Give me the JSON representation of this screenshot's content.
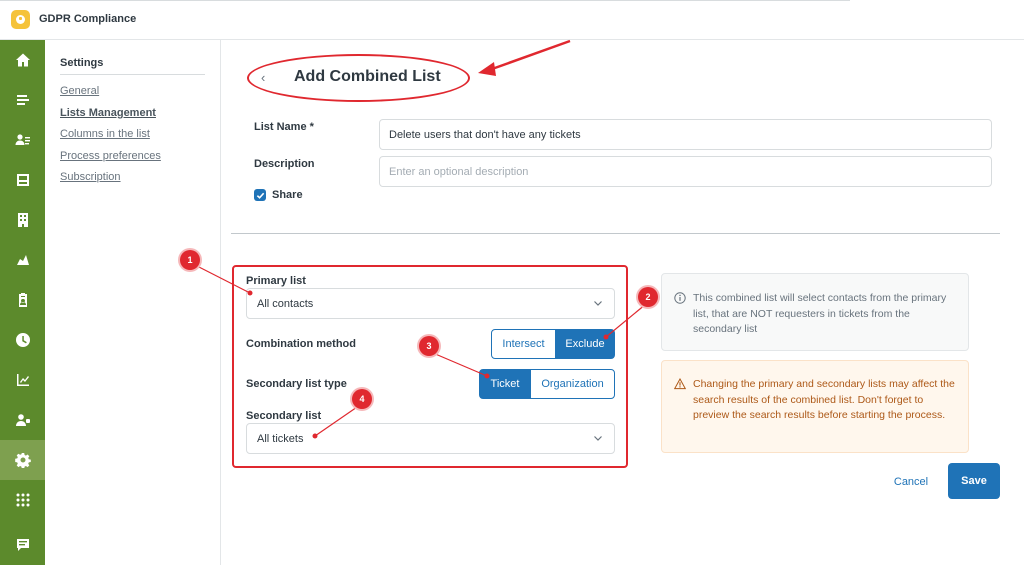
{
  "app": {
    "title": "GDPR Compliance"
  },
  "rail": {
    "icons": [
      "home-icon",
      "views-icon",
      "customers-icon",
      "inbox-icon",
      "organization-icon",
      "contacts-icon",
      "clipboard-icon",
      "clock-icon",
      "reporting-icon",
      "admin-users-icon",
      "gear-icon",
      "apps-grid-icon",
      "chat-icon"
    ],
    "active": "gear-icon",
    "color": "#5c8a2c"
  },
  "subnav": {
    "title": "Settings",
    "items": [
      {
        "label": "General"
      },
      {
        "label": "Lists Management",
        "active": true
      },
      {
        "label": "Columns in the list"
      },
      {
        "label": "Process preferences"
      },
      {
        "label": "Subscription"
      }
    ]
  },
  "page": {
    "title": "Add Combined List",
    "back_icon": "chevron-left-icon"
  },
  "form": {
    "list_name_label": "List Name *",
    "list_name_value": "Delete users that don't have any tickets",
    "description_label": "Description",
    "description_placeholder": "Enter an optional description",
    "share_label": "Share",
    "share_checked": true,
    "primary_list_label": "Primary list",
    "primary_list_value": "All contacts",
    "combination_label": "Combination method",
    "combination_options": [
      "Intersect",
      "Exclude"
    ],
    "combination_selected": "Exclude",
    "secondary_type_label": "Secondary list type",
    "secondary_type_options": [
      "Ticket",
      "Organization"
    ],
    "secondary_type_selected": "Ticket",
    "secondary_list_label": "Secondary list",
    "secondary_list_value": "All tickets"
  },
  "info": {
    "text": "This combined list will select contacts from the primary list, that are NOT requesters in tickets from the secondary list",
    "icon": "info-icon"
  },
  "warning": {
    "text": "Changing the primary and secondary lists may affect the search results of the combined list. Don't forget to preview the search results before starting the process.",
    "icon": "warning-icon"
  },
  "actions": {
    "cancel": "Cancel",
    "save": "Save"
  },
  "annotations": {
    "markers": [
      "1",
      "2",
      "3",
      "4"
    ],
    "color": "#e0282f"
  },
  "colors": {
    "accent": "#1f73b7",
    "warning": "#ad5918"
  }
}
